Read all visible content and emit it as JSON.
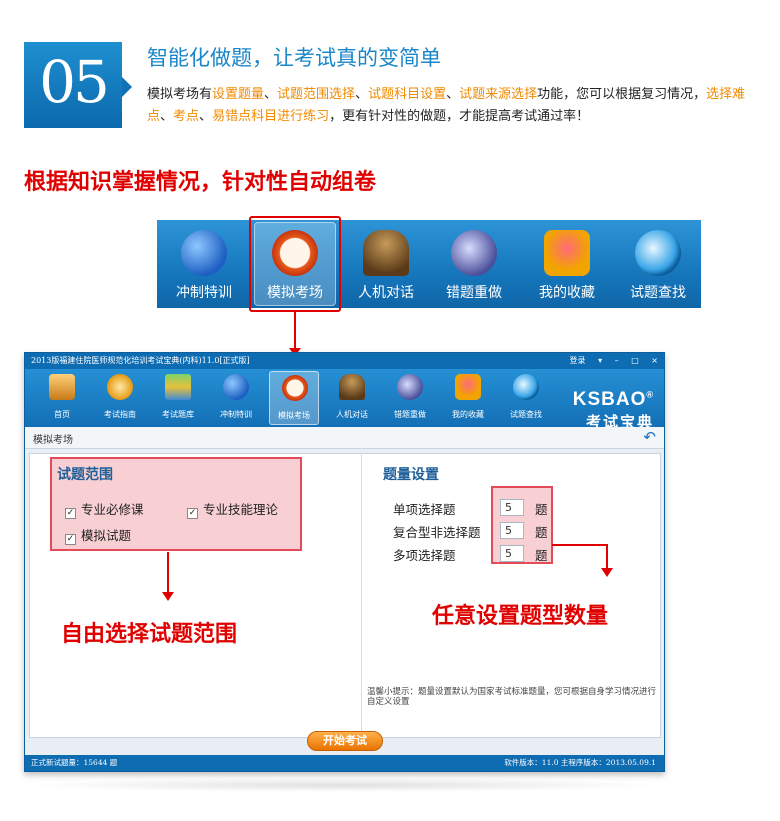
{
  "header": {
    "number": "05",
    "title": "智能化做题，让考试真的变简单",
    "desc_parts": {
      "p1": "模拟考场有",
      "h1": "设置题量",
      "s1": "、",
      "h2": "试题范围选择",
      "s2": "、",
      "h3": "试题科目设置",
      "s3": "、",
      "h4": "试题来源选择",
      "p2": "功能，您可以根据复习情况，",
      "h5": "选择难点",
      "s4": "、",
      "h6": "考点",
      "s5": "、",
      "h7": "易错点科目进行练习",
      "p3": "，更有针对性的做题，才能提高考试通过率！"
    },
    "colors": {
      "accent": "#1a86c9",
      "highlight": "#f08a00"
    }
  },
  "section_heading": "根据知识掌握情况，针对性自动组卷",
  "top_toolbar": {
    "items": [
      {
        "label": "冲制特训",
        "icon": "runner-icon"
      },
      {
        "label": "模拟考场",
        "icon": "clock-icon",
        "selected": true
      },
      {
        "label": "人机对话",
        "icon": "chess-knight-icon"
      },
      {
        "label": "错题重做",
        "icon": "pen-ink-icon"
      },
      {
        "label": "我的收藏",
        "icon": "gift-box-icon"
      },
      {
        "label": "试题查找",
        "icon": "magnifier-icon"
      }
    ]
  },
  "window": {
    "title": "2013版福建住院医师规范化培训考试宝典(内科)11.0[正式版]",
    "controls": {
      "login": "登录",
      "menu": "▾",
      "minimize": "–",
      "maximize": "□",
      "close": "×"
    },
    "toolbar": [
      {
        "label": "首页",
        "icon": "home-icon"
      },
      {
        "label": "考试指南",
        "icon": "compass-icon"
      },
      {
        "label": "考试题库",
        "icon": "books-icon"
      },
      {
        "label": "冲制特训",
        "icon": "runner-icon"
      },
      {
        "label": "模拟考场",
        "icon": "clock-icon",
        "selected": true
      },
      {
        "label": "人机对话",
        "icon": "chess-knight-icon"
      },
      {
        "label": "错题重做",
        "icon": "pen-ink-icon"
      },
      {
        "label": "我的收藏",
        "icon": "gift-box-icon"
      },
      {
        "label": "试题查找",
        "icon": "magnifier-icon"
      }
    ],
    "brand": {
      "name": "KSBAO",
      "reg": "®",
      "cn": "考试宝典"
    },
    "breadcrumb": "模拟考场",
    "range": {
      "title": "试题范围",
      "options": [
        {
          "label": "专业必修课",
          "checked": true
        },
        {
          "label": "专业技能理论",
          "checked": true
        },
        {
          "label": "模拟试题",
          "checked": true
        }
      ]
    },
    "quantity": {
      "title": "题量设置",
      "rows": [
        {
          "label": "单项选择题",
          "value": "5",
          "unit": "题"
        },
        {
          "label": "复合型非选择题",
          "value": "5",
          "unit": "题"
        },
        {
          "label": "多项选择题",
          "value": "5",
          "unit": "题"
        }
      ]
    },
    "hint": "温馨小提示：题量设置默认为国家考试标准题量，您可根据自身学习情况进行自定义设置",
    "start_button": "开始考试",
    "status_left": "正式新试题量：15644 题",
    "status_right": "软件版本：11.0  主程序版本：2013.05.09.1"
  },
  "annotations": {
    "range_caption": "自由选择试题范围",
    "quantity_caption": "任意设置题型数量",
    "color": "#e00000"
  }
}
